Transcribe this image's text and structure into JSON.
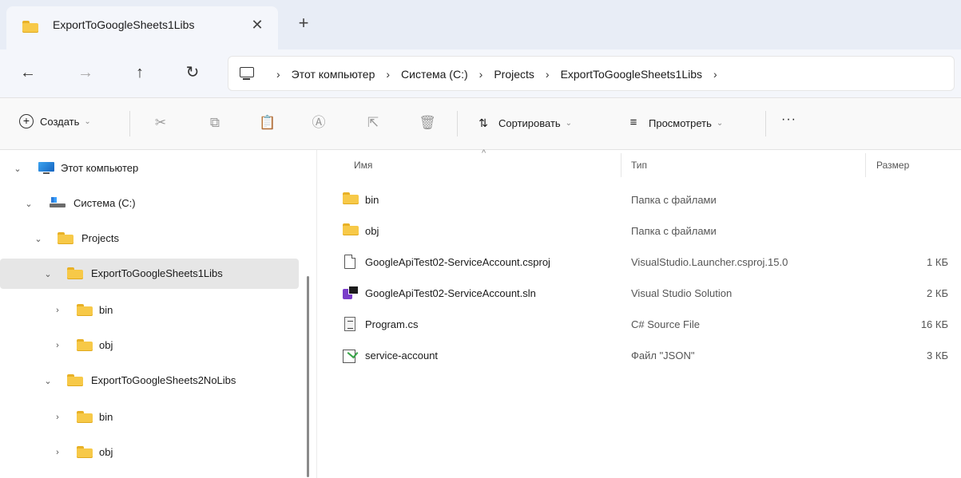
{
  "window": {
    "tab_title": "ExportToGoogleSheets1Libs",
    "tab_close": "✕",
    "new_tab": "+"
  },
  "nav": {
    "back": "←",
    "forward": "→",
    "up": "↑",
    "refresh": "↻",
    "breadcrumbs": [
      "Этот компьютер",
      "Система (C:)",
      "Projects",
      "ExportToGoogleSheets1Libs"
    ],
    "separator": "›"
  },
  "toolbar": {
    "create_label": "Создать",
    "sort_label": "Сортировать",
    "view_label": "Просмотреть",
    "more_label": "···",
    "icons": [
      "cut-icon",
      "copy-icon",
      "paste-icon",
      "rename-icon",
      "share-icon",
      "delete-icon"
    ]
  },
  "sidebar": {
    "items": [
      {
        "label": "Этот компьютер",
        "icon": "pc-icon",
        "expanded": true
      },
      {
        "label": "Система (C:)",
        "icon": "drive-icon",
        "expanded": true
      },
      {
        "label": "Projects",
        "icon": "folder-icon",
        "expanded": true
      },
      {
        "label": "ExportToGoogleSheets1Libs",
        "icon": "folder-icon",
        "expanded": true,
        "selected": true
      },
      {
        "label": "bin",
        "icon": "folder-icon",
        "expanded": false
      },
      {
        "label": "obj",
        "icon": "folder-icon",
        "expanded": false
      },
      {
        "label": "ExportToGoogleSheets2NoLibs",
        "icon": "folder-icon",
        "expanded": true
      },
      {
        "label": "bin",
        "icon": "folder-icon",
        "expanded": false
      },
      {
        "label": "obj",
        "icon": "folder-icon",
        "expanded": false
      }
    ]
  },
  "columns": {
    "name": "Имя",
    "type": "Тип",
    "size": "Размер"
  },
  "files": [
    {
      "name": "bin",
      "type": "Папка с файлами",
      "size": "",
      "icon": "folder-icon"
    },
    {
      "name": "obj",
      "type": "Папка с файлами",
      "size": "",
      "icon": "folder-icon"
    },
    {
      "name": "GoogleApiTest02-ServiceAccount.csproj",
      "type": "VisualStudio.Launcher.csproj.15.0",
      "size": "1 КБ",
      "icon": "csproj-file-icon"
    },
    {
      "name": "GoogleApiTest02-ServiceAccount.sln",
      "type": "Visual Studio Solution",
      "size": "2 КБ",
      "icon": "sln-file-icon"
    },
    {
      "name": "Program.cs",
      "type": "C# Source File",
      "size": "16 КБ",
      "icon": "cs-file-icon"
    },
    {
      "name": "service-account",
      "type": "Файл \"JSON\"",
      "size": "3 КБ",
      "icon": "json-file-icon"
    }
  ]
}
